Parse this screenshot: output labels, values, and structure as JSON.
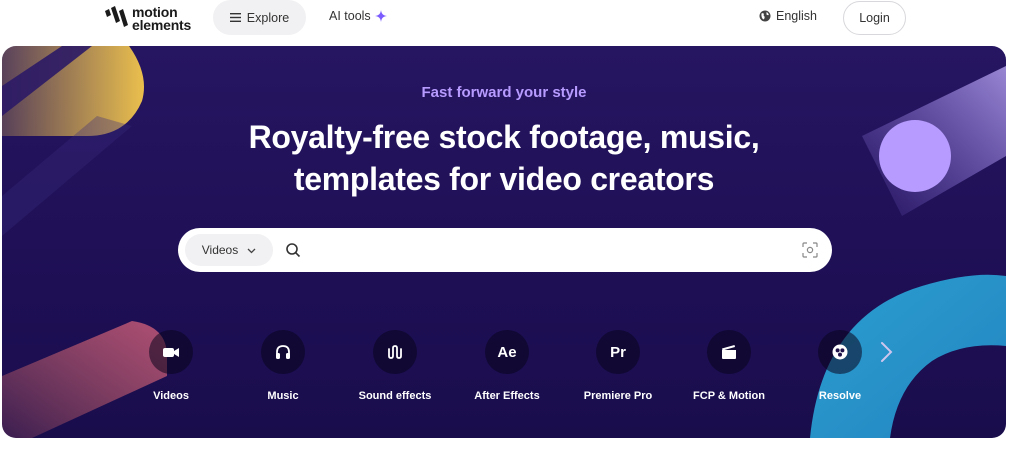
{
  "nav": {
    "logo_line1": "motion",
    "logo_line2": "elements",
    "explore_label": "Explore",
    "ai_tools_label": "AI tools",
    "language_label": "English",
    "login_label": "Login"
  },
  "hero": {
    "eyebrow": "Fast forward your style",
    "headline_line1": "Royalty-free stock footage, music,",
    "headline_line2": "templates for video creators"
  },
  "search": {
    "category_selected": "Videos",
    "value": "",
    "placeholder": ""
  },
  "categories": [
    {
      "label": "Videos",
      "icon": "video-camera-icon"
    },
    {
      "label": "Music",
      "icon": "headphones-icon"
    },
    {
      "label": "Sound effects",
      "icon": "sound-wave-icon"
    },
    {
      "label": "After Effects",
      "icon": "after-effects-icon",
      "glyph": "Ae"
    },
    {
      "label": "Premiere Pro",
      "icon": "premiere-pro-icon",
      "glyph": "Pr"
    },
    {
      "label": "FCP & Motion",
      "icon": "clapperboard-icon"
    },
    {
      "label": "Resolve",
      "icon": "resolve-icon"
    }
  ],
  "colors": {
    "hero_bg": "#261561",
    "eyebrow": "#b79bff",
    "accent_purple": "#7c5cff",
    "deco_yellow": "#f5c84c",
    "deco_lavender": "#b79bff",
    "deco_teal": "#2a9fd0"
  }
}
